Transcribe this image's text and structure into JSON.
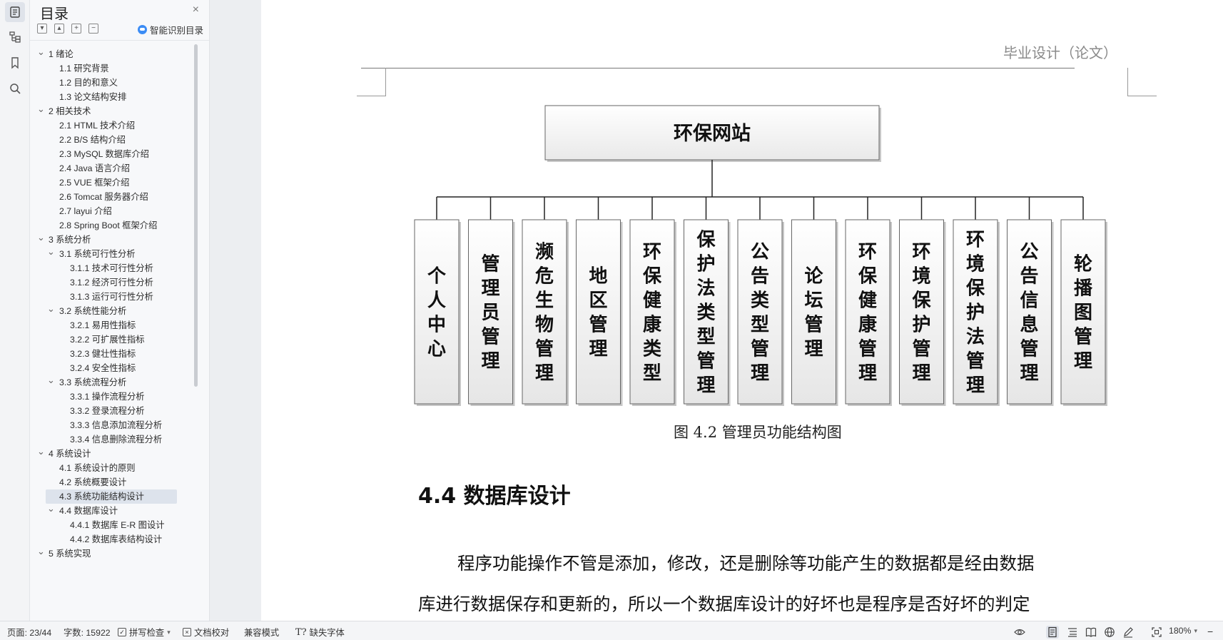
{
  "toc": {
    "title": "目录",
    "close": "×",
    "smart_label": "智能识别目录",
    "items": [
      {
        "label": "1  绪论",
        "level": 0,
        "expanded": true
      },
      {
        "label": "1.1  研究背景",
        "level": 1
      },
      {
        "label": "1.2  目的和意义",
        "level": 1
      },
      {
        "label": "1.3  论文结构安排",
        "level": 1
      },
      {
        "label": "2  相关技术",
        "level": 0,
        "expanded": true
      },
      {
        "label": "2.1 HTML 技术介绍",
        "level": 1
      },
      {
        "label": "2.2 B/S 结构介绍",
        "level": 1
      },
      {
        "label": "2.3 MySQL 数据库介绍",
        "level": 1
      },
      {
        "label": "2.4 Java 语言介绍",
        "level": 1
      },
      {
        "label": "2.5 VUE 框架介绍",
        "level": 1
      },
      {
        "label": "2.6 Tomcat 服务器介绍",
        "level": 1
      },
      {
        "label": "2.7 layui 介绍",
        "level": 1
      },
      {
        "label": "2.8 Spring Boot 框架介绍",
        "level": 1
      },
      {
        "label": "3  系统分析",
        "level": 0,
        "expanded": true
      },
      {
        "label": "3.1  系统可行性分析",
        "level": 1,
        "expanded": true
      },
      {
        "label": "3.1.1  技术可行性分析",
        "level": 2
      },
      {
        "label": "3.1.2  经济可行性分析",
        "level": 2
      },
      {
        "label": "3.1.3  运行可行性分析",
        "level": 2
      },
      {
        "label": "3.2  系统性能分析",
        "level": 1,
        "expanded": true
      },
      {
        "label": "3.2.1  易用性指标",
        "level": 2
      },
      {
        "label": "3.2.2  可扩展性指标",
        "level": 2
      },
      {
        "label": "3.2.3  健壮性指标",
        "level": 2
      },
      {
        "label": "3.2.4  安全性指标",
        "level": 2
      },
      {
        "label": "3.3  系统流程分析",
        "level": 1,
        "expanded": true
      },
      {
        "label": "3.3.1  操作流程分析",
        "level": 2
      },
      {
        "label": "3.3.2  登录流程分析",
        "level": 2
      },
      {
        "label": "3.3.3  信息添加流程分析",
        "level": 2
      },
      {
        "label": "3.3.4  信息删除流程分析",
        "level": 2
      },
      {
        "label": "4  系统设计",
        "level": 0,
        "expanded": true
      },
      {
        "label": "4.1  系统设计的原则",
        "level": 1
      },
      {
        "label": "4.2  系统概要设计",
        "level": 1
      },
      {
        "label": "4.3  系统功能结构设计",
        "level": 1,
        "selected": true
      },
      {
        "label": "4.4  数据库设计",
        "level": 1,
        "expanded": true
      },
      {
        "label": "4.4.1  数据库 E-R 图设计",
        "level": 2
      },
      {
        "label": "4.4.2  数据库表结构设计",
        "level": 2
      },
      {
        "label": "5  系统实现",
        "level": 0,
        "expanded": true
      }
    ]
  },
  "document": {
    "header": "毕业设计（论文）",
    "diagram": {
      "root": "环保网站",
      "children": [
        "个人中心",
        "管理员管理",
        "濒危生物管理",
        "地区管理",
        "环保健康类型",
        "保护法类型管理",
        "公告类型管理",
        "论坛管理",
        "环保健康管理",
        "环境保护管理",
        "环境保护法管理",
        "公告信息管理",
        "轮播图管理"
      ]
    },
    "caption": "图 4.2  管理员功能结构图",
    "section_heading": "4.4  数据库设计",
    "body_line_1": "程序功能操作不管是添加，修改，还是删除等功能产生的数据都是经由数据",
    "body_line_2": "库进行数据保存和更新的，所以一个数据库设计的好坏也是程序是否好坏的判定"
  },
  "status_bar": {
    "page": "页面: 23/44",
    "word_count": "字数: 15922",
    "spell_check": "拼写检查",
    "proofread": "文档校对",
    "compat_mode": "兼容模式",
    "missing_font": "缺失字体",
    "zoom": "180%"
  }
}
